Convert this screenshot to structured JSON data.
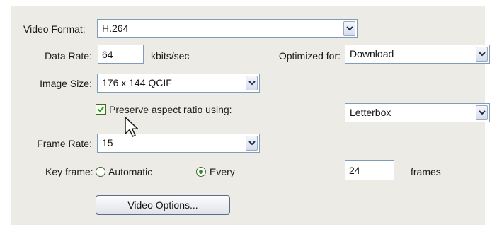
{
  "video_format": {
    "label": "Video Format:",
    "value": "H.264"
  },
  "data_rate": {
    "label": "Data Rate:",
    "value": "64",
    "unit": "kbits/sec"
  },
  "optimized_for": {
    "label": "Optimized for:",
    "value": "Download"
  },
  "image_size": {
    "label": "Image Size:",
    "value": "176 x 144 QCIF"
  },
  "preserve_aspect": {
    "label": "Preserve aspect ratio using:",
    "checked": true,
    "method": "Letterbox"
  },
  "frame_rate": {
    "label": "Frame Rate:",
    "value": "15"
  },
  "key_frame": {
    "label": "Key frame:",
    "automatic_label": "Automatic",
    "every_label": "Every",
    "selected": "every",
    "value": "24",
    "unit": "frames"
  },
  "video_options_button": {
    "label": "Video Options..."
  },
  "colors": {
    "panel": "#ecebe5",
    "field_border": "#7f9db9",
    "check_green": "#3a8a2a"
  },
  "icons": {
    "dropdown": "chevron-down-icon",
    "checkbox": "checkmark-icon",
    "pointer": "mouse-cursor-icon"
  }
}
